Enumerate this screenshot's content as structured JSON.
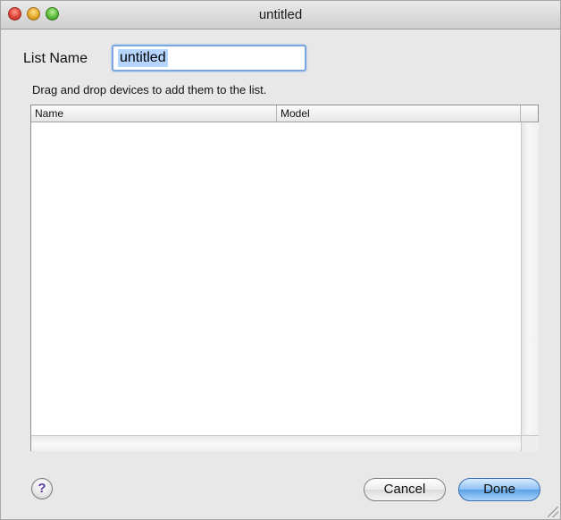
{
  "window": {
    "title": "untitled"
  },
  "form": {
    "list_name_label": "List Name",
    "list_name_value": "untitled",
    "hint": "Drag and drop devices to add them to the list."
  },
  "table": {
    "columns": [
      "Name",
      "Model"
    ],
    "rows": []
  },
  "buttons": {
    "help_label": "?",
    "cancel_label": "Cancel",
    "done_label": "Done"
  },
  "colors": {
    "default_button": "#5aa1e6",
    "focus_ring": "#7aa7e0",
    "selection": "#b5d5ff"
  }
}
